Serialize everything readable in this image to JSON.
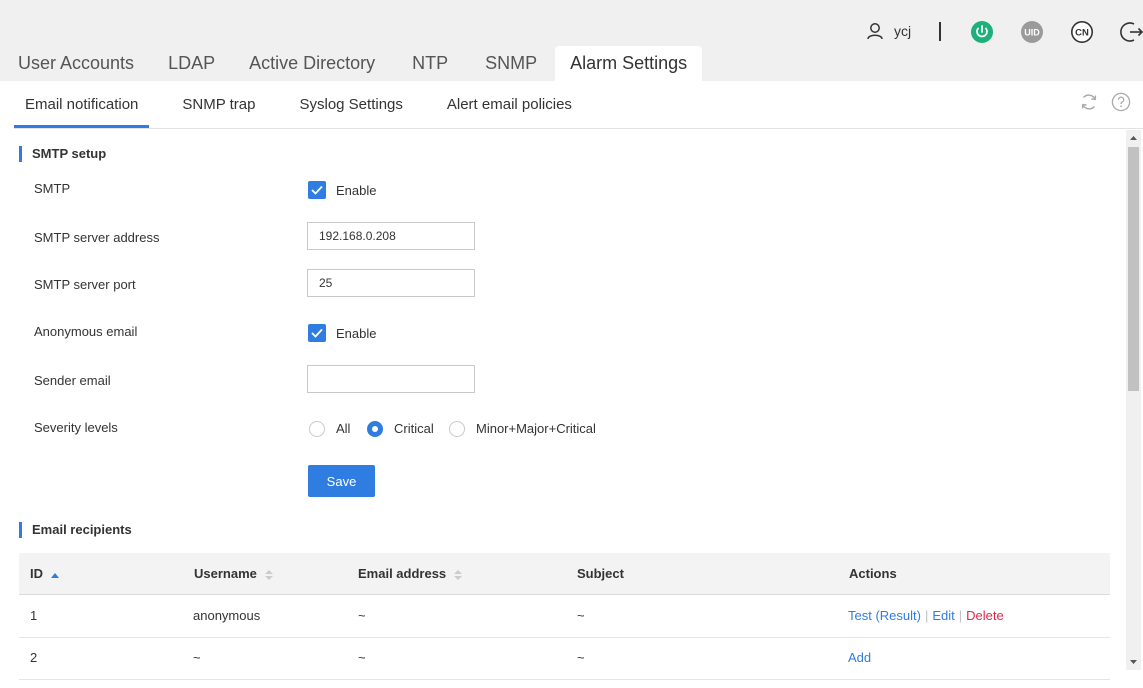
{
  "header": {
    "username": "ycj",
    "icons": [
      "user-icon",
      "power-icon",
      "uid-icon",
      "language-cn-icon",
      "logout-icon"
    ],
    "uid_text": "UID",
    "lang_text": "CN",
    "colors": {
      "power": "#1db07c",
      "uid_bg": "#9a9a9a",
      "accent": "#2f7de1",
      "danger": "#e0294a"
    }
  },
  "main_tabs": [
    {
      "label": "User Accounts"
    },
    {
      "label": "LDAP"
    },
    {
      "label": "Active Directory"
    },
    {
      "label": "NTP"
    },
    {
      "label": "SNMP"
    },
    {
      "label": "Alarm Settings",
      "active": true
    }
  ],
  "sub_tabs": [
    {
      "label": "Email notification",
      "active": true
    },
    {
      "label": "SNMP trap"
    },
    {
      "label": "Syslog Settings"
    },
    {
      "label": "Alert email policies"
    }
  ],
  "smtp": {
    "section_title": "SMTP setup",
    "smtp_label": "SMTP",
    "smtp_enabled": true,
    "enable_label": "Enable",
    "server_address_label": "SMTP server address",
    "server_address_value": "192.168.0.208",
    "server_port_label": "SMTP server port",
    "server_port_value": "25",
    "anonymous_label": "Anonymous email",
    "anonymous_enabled": true,
    "sender_label": "Sender email",
    "sender_value": "",
    "severity_label": "Severity levels",
    "severity_options": [
      "All",
      "Critical",
      "Minor+Major+Critical"
    ],
    "severity_selected": "Critical",
    "save_label": "Save"
  },
  "recipients": {
    "section_title": "Email recipients",
    "columns": [
      "ID",
      "Username",
      "Email address",
      "Subject",
      "Actions"
    ],
    "rows": [
      {
        "id": "1",
        "username": "anonymous",
        "email": "~",
        "subject": "~",
        "actions": {
          "test": "Test",
          "result": "(Result)",
          "edit": "Edit",
          "delete": "Delete"
        }
      },
      {
        "id": "2",
        "username": "~",
        "email": "~",
        "subject": "~",
        "actions": {
          "add": "Add"
        }
      }
    ]
  }
}
